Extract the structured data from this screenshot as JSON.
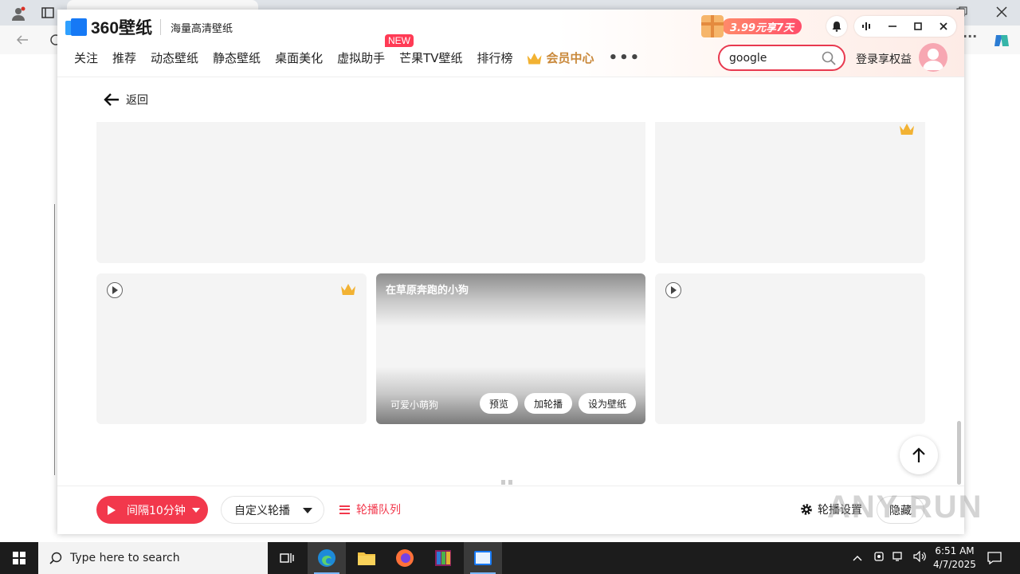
{
  "app": {
    "logo_text": "360壁纸",
    "slogan": "海量高清壁纸",
    "promo_text": "3.99元享7天",
    "nav": {
      "items": [
        "关注",
        "推荐",
        "动态壁纸",
        "静态壁纸",
        "桌面美化",
        "虚拟助手",
        "芒果TV壁纸",
        "排行榜"
      ],
      "vip_label": "会员中心",
      "new_badge": "NEW"
    },
    "search": {
      "value": "google"
    },
    "login_label": "登录享权益",
    "back_label": "返回",
    "active_card": {
      "title": "在草原奔跑的小狗",
      "subtitle": "可爱小萌狗",
      "buttons": [
        "预览",
        "加轮播",
        "设为壁纸"
      ]
    },
    "bottom": {
      "interval_label": "间隔10分钟",
      "custom_label": "自定义轮播",
      "queue_label": "轮播队列",
      "settings_label": "轮播设置",
      "hide_label": "隐藏"
    },
    "watermark": "ANY RUN"
  },
  "taskbar": {
    "search_placeholder": "Type here to search",
    "time": "6:51 AM",
    "date": "4/7/2025"
  },
  "colors": {
    "accent": "#f2384c",
    "vip_gold": "#c9883a",
    "card_bg": "#f4f4f4"
  }
}
